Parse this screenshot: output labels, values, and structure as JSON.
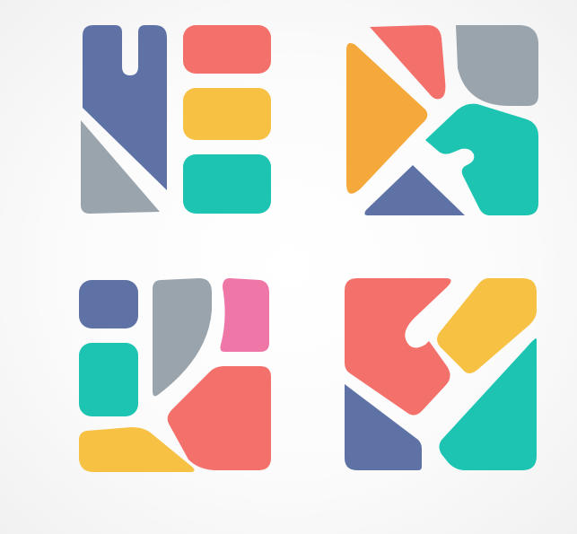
{
  "icons": [
    {
      "name": "stripes-mosaic-icon",
      "colors": [
        "#5e72a6",
        "#f4706b",
        "#f7c244",
        "#1cc4b1",
        "#9aa4ad"
      ]
    },
    {
      "name": "triangle-mosaic-icon",
      "colors": [
        "#f4706b",
        "#9aa4ad",
        "#f5a93a",
        "#1cc4b1",
        "#5e72a6"
      ]
    },
    {
      "name": "rounded-blocks-mosaic-icon",
      "colors": [
        "#5e72a6",
        "#9aa4ad",
        "#ef77a8",
        "#1cc4b1",
        "#f4706b",
        "#f7c244"
      ]
    },
    {
      "name": "diagonal-mosaic-icon",
      "colors": [
        "#f4706b",
        "#f7c244",
        "#5e72a6",
        "#1cc4b1"
      ]
    }
  ]
}
